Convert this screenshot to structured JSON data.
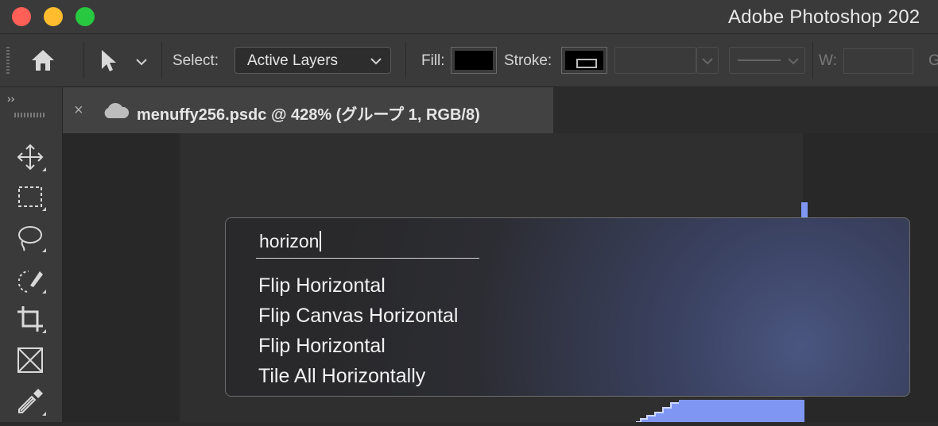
{
  "window": {
    "title": "Adobe Photoshop 202"
  },
  "options_bar": {
    "select_label": "Select:",
    "select_value": "Active Layers",
    "fill_label": "Fill:",
    "stroke_label": "Stroke:",
    "width_label": "W:",
    "cutoff_label": "G",
    "fill_color": "#000000",
    "stroke_color": "#000000"
  },
  "document": {
    "tab_title": "menuffy256.psdc @ 428% (グループ 1, RGB/8)",
    "close_glyph": "×"
  },
  "tools_panel": {
    "expand_glyph": "››",
    "tools": [
      "move-tool",
      "marquee-tool",
      "lasso-tool",
      "object-select-tool",
      "crop-tool",
      "frame-tool",
      "eyedropper-tool"
    ]
  },
  "search_popup": {
    "query": "horizon",
    "results": [
      "Flip Horizontal",
      "Flip Canvas Horizontal",
      "Flip Horizontal",
      "Tile All Horizontally"
    ]
  },
  "colors": {
    "accent_blue": "#7f97f3",
    "traffic_close": "#fe5f57",
    "traffic_min": "#febc2e",
    "traffic_max": "#28c840"
  }
}
